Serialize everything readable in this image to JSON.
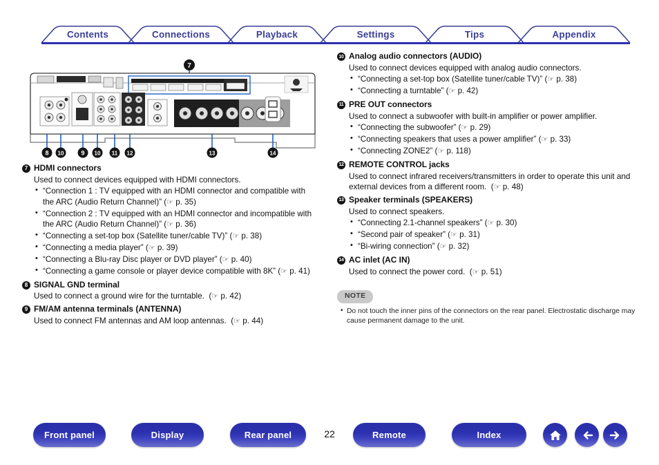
{
  "tabs": [
    {
      "label": "Contents"
    },
    {
      "label": "Connections"
    },
    {
      "label": "Playback"
    },
    {
      "label": "Settings"
    },
    {
      "label": "Tips"
    },
    {
      "label": "Appendix"
    }
  ],
  "diagram": {
    "name": "rear-panel-diagram",
    "callouts": [
      "7",
      "8",
      "10",
      "9",
      "10",
      "11",
      "12",
      "13",
      "14"
    ]
  },
  "left_column": [
    {
      "num": "7",
      "title": "HDMI connectors",
      "desc": "Used to connect devices equipped with HDMI connectors.",
      "bullets": [
        {
          "text": "“Connection 1 : TV equipped with an HDMI connector and compatible with the ARC (Audio Return Channel)” (",
          "page": "p. 35",
          "close": ")"
        },
        {
          "text": "“Connection 2 : TV equipped with an HDMI connector and incompatible with the ARC (Audio Return Channel)” (",
          "page": "p. 36",
          "close": ")"
        },
        {
          "text": "“Connecting a set-top box (Satellite tuner/cable TV)” (",
          "page": "p. 38",
          "close": ")"
        },
        {
          "text": "“Connecting a media player” (",
          "page": "p. 39",
          "close": ")"
        },
        {
          "text": "“Connecting a Blu-ray Disc player or DVD player” (",
          "page": "p. 40",
          "close": ")"
        },
        {
          "text": "“Connecting a game console or player device compatible with 8K” (",
          "page": "p. 41",
          "close": ")"
        }
      ]
    },
    {
      "num": "8",
      "title": "SIGNAL GND terminal",
      "desc": "Used to connect a ground wire for the turntable.",
      "desc_page": "p. 42",
      "bullets": []
    },
    {
      "num": "9",
      "title": "FM/AM antenna terminals (ANTENNA)",
      "desc": "Used to connect FM antennas and AM loop antennas.",
      "desc_page": "p. 44",
      "bullets": []
    }
  ],
  "right_column": [
    {
      "num": "10",
      "title": "Analog audio connectors (AUDIO)",
      "desc": "Used to connect devices equipped with analog audio connectors.",
      "bullets": [
        {
          "text": "“Connecting a set-top box (Satellite tuner/cable TV)” (",
          "page": "p. 38",
          "close": ")"
        },
        {
          "text": "“Connecting a turntable” (",
          "page": "p. 42",
          "close": ")"
        }
      ]
    },
    {
      "num": "11",
      "title": "PRE OUT connectors",
      "desc": "Used to connect a subwoofer with built-in amplifier or power amplifier.",
      "bullets": [
        {
          "text": "“Connecting the subwoofer” (",
          "page": "p. 29",
          "close": ")"
        },
        {
          "text": "“Connecting speakers that uses a power amplifier” (",
          "page": "p. 33",
          "close": ")"
        },
        {
          "text": "“Connecting ZONE2” (",
          "page": "p. 118",
          "close": ")"
        }
      ]
    },
    {
      "num": "12",
      "title": "REMOTE CONTROL jacks",
      "desc": "Used to connect infrared receivers/transmitters in order to operate this unit and external devices from a different room.",
      "desc_page": "p. 48",
      "bullets": []
    },
    {
      "num": "13",
      "title": "Speaker terminals (SPEAKERS)",
      "desc": "Used to connect speakers.",
      "bullets": [
        {
          "text": "“Connecting 2.1-channel speakers” (",
          "page": "p. 30",
          "close": ")"
        },
        {
          "text": "“Second pair of speaker” (",
          "page": "p. 31",
          "close": ")"
        },
        {
          "text": "“Bi-wiring connection” (",
          "page": "p. 32",
          "close": ")"
        }
      ]
    },
    {
      "num": "14",
      "title": "AC inlet (AC IN)",
      "desc": "Used to connect the power cord.",
      "desc_page": "p. 51",
      "bullets": []
    }
  ],
  "note": {
    "badge": "NOTE",
    "items": [
      "Do not touch the inner pins of the connectors on the rear panel. Electrostatic discharge may cause permanent damage to the unit."
    ]
  },
  "footer": {
    "buttons": [
      {
        "label": "Front panel",
        "name": "front-panel-button"
      },
      {
        "label": "Display",
        "name": "display-button"
      },
      {
        "label": "Rear panel",
        "name": "rear-panel-button"
      },
      {
        "label": "Remote",
        "name": "remote-button"
      },
      {
        "label": "Index",
        "name": "index-button"
      }
    ],
    "page_number": "22",
    "icons": [
      "home-icon",
      "back-arrow-icon",
      "forward-arrow-icon"
    ]
  },
  "colors": {
    "tab_text": "#3b3f96",
    "tab_outline": "#3b3f96",
    "button_blue": "#2b30ae",
    "leader_line": "#1d63c4",
    "note_badge_bg": "#c9c9c9"
  }
}
